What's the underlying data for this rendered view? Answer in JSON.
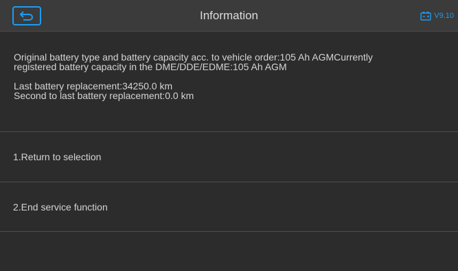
{
  "header": {
    "title": "Information",
    "back_icon": "back-arrow-icon",
    "battery_icon": "battery-icon",
    "version": "V9.10",
    "accent_color": "#1e9bf0"
  },
  "info": {
    "line1": "Original battery type and battery capacity acc. to vehicle order:105 Ah AGMCurrently",
    "line2": "registered battery capacity in the DME/DDE/EDME:105 Ah AGM",
    "line3": "Last battery replacement:34250.0 km",
    "line4": "Second to last battery replacement:0.0 km"
  },
  "menu": {
    "items": [
      {
        "label": "1.Return to selection"
      },
      {
        "label": "2.End service function"
      }
    ]
  }
}
